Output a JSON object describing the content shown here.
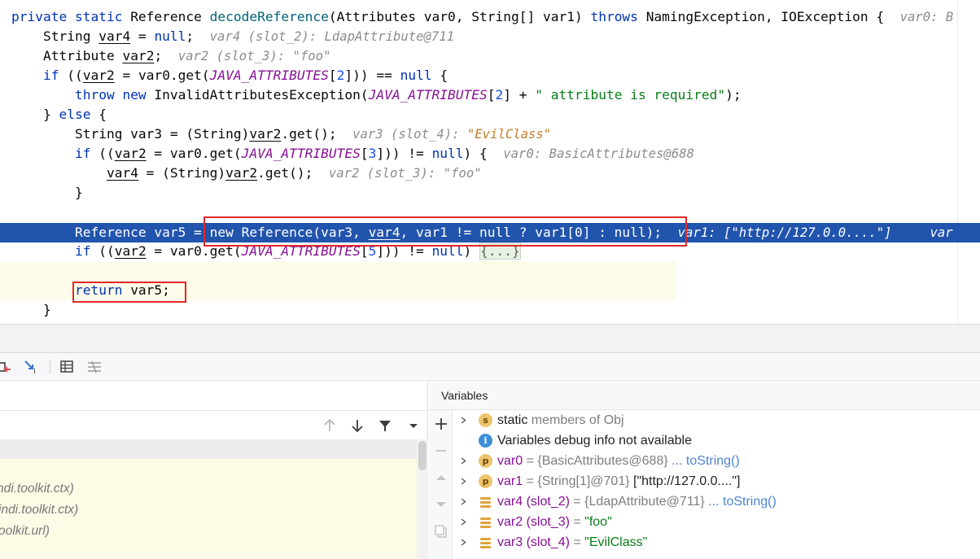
{
  "editor": {
    "lines": [
      {
        "id": "l1",
        "parts": [
          [
            "kw",
            "private static "
          ],
          [
            "",
            "Reference "
          ],
          [
            "mth",
            "decodeReference"
          ],
          [
            "",
            "(Attributes var0, String[] var1) "
          ],
          [
            "kw",
            "throws "
          ],
          [
            "",
            "NamingException, IOException {  "
          ],
          [
            "hint",
            "var0: B"
          ]
        ]
      },
      {
        "id": "l2",
        "parts": [
          [
            "",
            "    String "
          ],
          [
            "ul",
            "var4"
          ],
          [
            "",
            " = "
          ],
          [
            "kw",
            "null"
          ],
          [
            ";  "
          ],
          [
            "hint",
            "var4 (slot_2): LdapAttribute@711"
          ]
        ]
      },
      {
        "id": "l3",
        "parts": [
          [
            "",
            "    Attribute "
          ],
          [
            "ul",
            "var2"
          ],
          [
            ";  "
          ],
          [
            "hint",
            "var2 (slot_3): \"foo\""
          ]
        ]
      },
      {
        "id": "l4",
        "parts": [
          [
            "kw",
            "    if "
          ],
          [
            "",
            "(("
          ],
          [
            "ul",
            "var2"
          ],
          [
            "",
            " = var0.get("
          ],
          [
            "fld",
            "JAVA_ATTRIBUTES"
          ],
          [
            "",
            "["
          ],
          [
            "num",
            "2"
          ],
          [
            "",
            "])) == "
          ],
          [
            "kw",
            "null"
          ],
          [
            "",
            " {"
          ]
        ]
      },
      {
        "id": "l5",
        "parts": [
          [
            "kw",
            "        throw new "
          ],
          [
            "",
            "InvalidAttributesException("
          ],
          [
            "fld",
            "JAVA_ATTRIBUTES"
          ],
          [
            "",
            "["
          ],
          [
            "num",
            "2"
          ],
          [
            "",
            "] + "
          ],
          [
            "str",
            "\" attribute is required\""
          ],
          [
            "",
            ");"
          ]
        ]
      },
      {
        "id": "l6",
        "parts": [
          [
            "",
            "    } "
          ],
          [
            "kw",
            "else "
          ],
          [
            "",
            "{"
          ]
        ]
      },
      {
        "id": "l7",
        "parts": [
          [
            "",
            "        String var3 = (String)"
          ],
          [
            "ul",
            "var2"
          ],
          [
            "",
            ".get();  "
          ],
          [
            "hint",
            "var3 (slot_4): "
          ],
          [
            "hintv",
            "\"EvilClass\""
          ]
        ]
      },
      {
        "id": "l8",
        "parts": [
          [
            "kw",
            "        if "
          ],
          [
            "",
            "(("
          ],
          [
            "ul",
            "var2"
          ],
          [
            "",
            " = var0.get("
          ],
          [
            "fld",
            "JAVA_ATTRIBUTES"
          ],
          [
            "",
            "["
          ],
          [
            "num",
            "3"
          ],
          [
            "",
            "])) != "
          ],
          [
            "kw",
            "null"
          ],
          [
            "",
            ") {  "
          ],
          [
            "hint",
            "var0: BasicAttributes@688"
          ]
        ]
      },
      {
        "id": "l9",
        "parts": [
          [
            "",
            "            "
          ],
          [
            "ul",
            "var4"
          ],
          [
            "",
            " = (String)"
          ],
          [
            "ul",
            "var2"
          ],
          [
            "",
            ".get();  "
          ],
          [
            "hint",
            "var2 (slot_3): \"foo\""
          ]
        ]
      },
      {
        "id": "l10",
        "parts": [
          [
            "",
            "        }"
          ]
        ]
      },
      {
        "id": "l11",
        "parts": [
          [
            "",
            ""
          ]
        ]
      },
      {
        "id": "l12",
        "parts": [
          [
            "",
            "        Reference var5 = new Reference(var3, "
          ],
          [
            "ul",
            "var4"
          ],
          [
            "",
            ", var1 != null ? var1[0] : null);  "
          ],
          [
            "hint",
            "var1: [\"http://127.0.0....\"]     var"
          ]
        ]
      },
      {
        "id": "l13",
        "parts": [
          [
            "kw",
            "        if "
          ],
          [
            "",
            "(("
          ],
          [
            "ul",
            "var2"
          ],
          [
            "",
            " = var0.get("
          ],
          [
            "fld",
            "JAVA_ATTRIBUTES"
          ],
          [
            "",
            "["
          ],
          [
            "num",
            "5"
          ],
          [
            "",
            "])) != "
          ],
          [
            "kw",
            "null"
          ],
          [
            "",
            ") "
          ],
          [
            "fold",
            "{...}"
          ]
        ]
      },
      {
        "id": "l14",
        "parts": [
          [
            "",
            ""
          ]
        ]
      },
      {
        "id": "l15",
        "parts": [
          [
            "kw",
            "        return "
          ],
          [
            "",
            "var5;"
          ]
        ]
      },
      {
        "id": "l16",
        "parts": [
          [
            "",
            "    }"
          ]
        ]
      }
    ]
  },
  "frames": {
    "items": [
      "ndi.toolkit.ctx)",
      "jndi.toolkit.ctx)",
      "oolkit.url)"
    ]
  },
  "variables": {
    "title": "Variables",
    "rows": [
      {
        "expand": true,
        "icon": "s",
        "name": "static",
        "rest": " members of Obj",
        "name_style": "dark",
        "link": ""
      },
      {
        "expand": false,
        "icon": "i",
        "name": "Variables debug info not available",
        "rest": "",
        "name_style": "dark",
        "link": ""
      },
      {
        "expand": true,
        "icon": "p",
        "name": "var0",
        "rest": " = {BasicAttributes@688} ",
        "name_style": "purple",
        "link": "... toString()"
      },
      {
        "expand": true,
        "icon": "p",
        "name": "var1",
        "rest": " = {String[1]@701} ",
        "name_style": "purple",
        "link": "",
        "plain": "[\"http://127.0.0....\"]"
      },
      {
        "expand": true,
        "icon": "slot",
        "name": "var4 (slot_2)",
        "rest": " = {LdapAttribute@711} ",
        "name_style": "purple",
        "link": "... toString()"
      },
      {
        "expand": true,
        "icon": "slot",
        "name": "var2 (slot_3)",
        "rest": " = ",
        "name_style": "purple",
        "link": "",
        "str": "\"foo\""
      },
      {
        "expand": true,
        "icon": "slot",
        "name": "var3 (slot_4)",
        "rest": " = ",
        "name_style": "purple",
        "link": "",
        "str": "\"EvilClass\""
      }
    ]
  },
  "colors": {
    "execution_line": "#2154ac",
    "annotation_box": "#e22828",
    "frames_background": "#fbfbe6"
  }
}
